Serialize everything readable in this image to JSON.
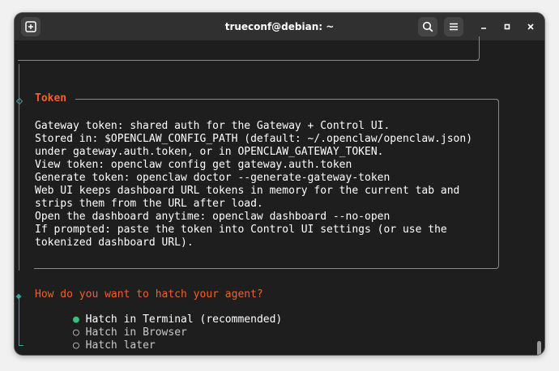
{
  "window": {
    "title": "trueconf@debian: ~",
    "controls": {
      "minimize": "–",
      "maximize": "▫",
      "close": "×"
    }
  },
  "icons": {
    "new_tab": "new-tab-icon",
    "search": "search-icon",
    "menu": "hamburger-menu-icon"
  },
  "colors": {
    "accent_orange": "#f0602e",
    "accent_teal": "#3aa3a3",
    "selected_green": "#33c37b",
    "text": "#ffffff",
    "muted": "#c9c9c9"
  },
  "token_section": {
    "heading": "Token",
    "lines": [
      "Gateway token: shared auth for the Gateway + Control UI.",
      "Stored in: $OPENCLAW_CONFIG_PATH (default: ~/.openclaw/openclaw.json)",
      "under gateway.auth.token, or in OPENCLAW_GATEWAY_TOKEN.",
      "View token: openclaw config get gateway.auth.token",
      "Generate token: openclaw doctor --generate-gateway-token",
      "Web UI keeps dashboard URL tokens in memory for the current tab and",
      "strips them from the URL after load.",
      "Open the dashboard anytime: openclaw dashboard --no-open",
      "If prompted: paste the token into Control UI settings (or use the",
      "tokenized dashboard URL)."
    ]
  },
  "prompt": {
    "question": "How do you want to hatch your agent?",
    "options": [
      {
        "label": "Hatch in Terminal (recommended)",
        "marker": "●",
        "selected": true
      },
      {
        "label": "Hatch in Browser",
        "marker": "○",
        "selected": false
      },
      {
        "label": "Hatch later",
        "marker": "○",
        "selected": false
      }
    ]
  }
}
